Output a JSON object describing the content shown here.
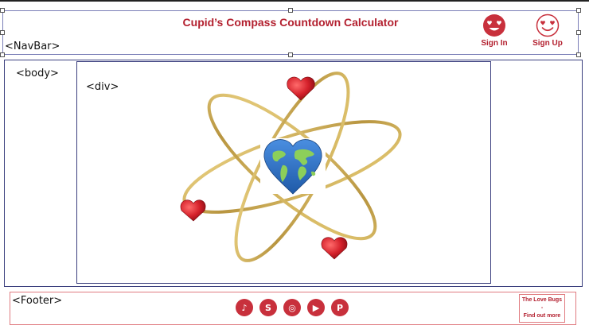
{
  "navbar": {
    "label": "<NavBar>",
    "title": "Cupid’s Compass Countdown Calculator",
    "sign_in": "Sign In",
    "sign_up": "Sign Up",
    "sign_in_icon": "smiley-heart-eyes-filled",
    "sign_up_icon": "smiley-heart-eyes-outline"
  },
  "body": {
    "label": "<body>"
  },
  "div": {
    "label": "<div>",
    "illustration": "atom-orbits-with-hearts-and-globe-heart"
  },
  "footer": {
    "label": "<Footer>",
    "social_icons": [
      {
        "name": "tiktok-icon",
        "glyph": "♪"
      },
      {
        "name": "skype-icon",
        "glyph": "S"
      },
      {
        "name": "instagram-icon",
        "glyph": "◎"
      },
      {
        "name": "youtube-icon",
        "glyph": "▶"
      },
      {
        "name": "pinterest-icon",
        "glyph": "P"
      }
    ],
    "info_box": {
      "line1": "The Love Bugs",
      "line2": "-",
      "line3": "Find out more"
    }
  },
  "colors": {
    "brand_red": "#b3202f",
    "icon_red": "#c8303c",
    "outline_blue": "#3b3f7e",
    "footer_pink": "#e07b80"
  }
}
